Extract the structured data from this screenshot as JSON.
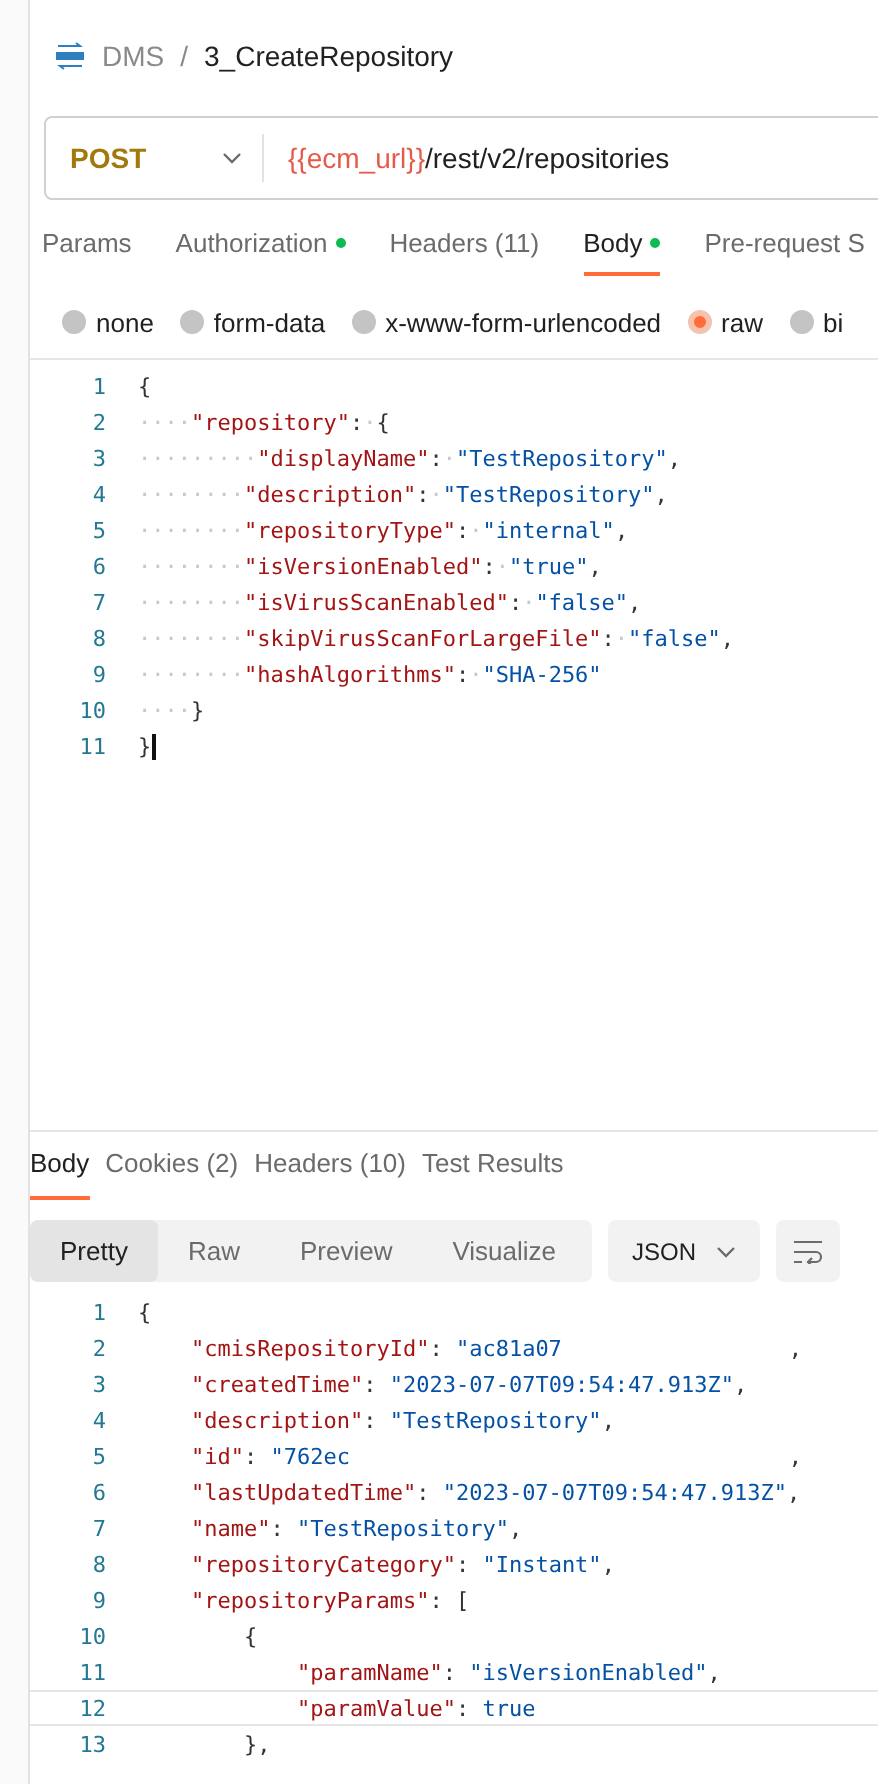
{
  "breadcrumb": {
    "collection": "DMS",
    "separator": "/",
    "request": "3_CreateRepository"
  },
  "request": {
    "method": "POST",
    "url_variable": "{{ecm_url}}",
    "url_path": "/rest/v2/repositories"
  },
  "request_tabs": [
    {
      "label": "Params",
      "selected": false,
      "dot": false
    },
    {
      "label": "Authorization",
      "selected": false,
      "dot": true
    },
    {
      "label": "Headers (11)",
      "selected": false,
      "dot": false
    },
    {
      "label": "Body",
      "selected": true,
      "dot": true
    },
    {
      "label": "Pre-request S",
      "selected": false,
      "dot": false
    }
  ],
  "body_types": [
    {
      "label": "none",
      "selected": false
    },
    {
      "label": "form-data",
      "selected": false
    },
    {
      "label": "x-www-form-urlencoded",
      "selected": false
    },
    {
      "label": "raw",
      "selected": true
    },
    {
      "label": "bi",
      "selected": false
    }
  ],
  "request_body": {
    "lines": [
      {
        "number": "1",
        "active": false,
        "tokens": [
          {
            "kind": "punct",
            "text": "{"
          }
        ]
      },
      {
        "number": "2",
        "active": false,
        "tokens": [
          {
            "kind": "ws",
            "text": "····"
          },
          {
            "kind": "key",
            "text": "\"repository\""
          },
          {
            "kind": "punct",
            "text": ":"
          },
          {
            "kind": "ws",
            "text": "·"
          },
          {
            "kind": "punct",
            "text": "{"
          }
        ]
      },
      {
        "number": "3",
        "active": false,
        "tokens": [
          {
            "kind": "ws",
            "text": "·········"
          },
          {
            "kind": "key",
            "text": "\"displayName\""
          },
          {
            "kind": "punct",
            "text": ":"
          },
          {
            "kind": "ws",
            "text": "·"
          },
          {
            "kind": "string",
            "text": "\"TestRepository\""
          },
          {
            "kind": "punct",
            "text": ","
          }
        ]
      },
      {
        "number": "4",
        "active": false,
        "tokens": [
          {
            "kind": "ws",
            "text": "········"
          },
          {
            "kind": "key",
            "text": "\"description\""
          },
          {
            "kind": "punct",
            "text": ":"
          },
          {
            "kind": "ws",
            "text": "·"
          },
          {
            "kind": "string",
            "text": "\"TestRepository\""
          },
          {
            "kind": "punct",
            "text": ","
          }
        ]
      },
      {
        "number": "5",
        "active": false,
        "tokens": [
          {
            "kind": "ws",
            "text": "········"
          },
          {
            "kind": "key",
            "text": "\"repositoryType\""
          },
          {
            "kind": "punct",
            "text": ":"
          },
          {
            "kind": "ws",
            "text": "·"
          },
          {
            "kind": "string",
            "text": "\"internal\""
          },
          {
            "kind": "punct",
            "text": ","
          }
        ]
      },
      {
        "number": "6",
        "active": false,
        "tokens": [
          {
            "kind": "ws",
            "text": "········"
          },
          {
            "kind": "key",
            "text": "\"isVersionEnabled\""
          },
          {
            "kind": "punct",
            "text": ":"
          },
          {
            "kind": "ws",
            "text": "·"
          },
          {
            "kind": "string",
            "text": "\"true\""
          },
          {
            "kind": "punct",
            "text": ","
          }
        ]
      },
      {
        "number": "7",
        "active": false,
        "tokens": [
          {
            "kind": "ws",
            "text": "········"
          },
          {
            "kind": "key",
            "text": "\"isVirusScanEnabled\""
          },
          {
            "kind": "punct",
            "text": ":"
          },
          {
            "kind": "ws",
            "text": "·"
          },
          {
            "kind": "string",
            "text": "\"false\""
          },
          {
            "kind": "punct",
            "text": ","
          }
        ]
      },
      {
        "number": "8",
        "active": false,
        "tokens": [
          {
            "kind": "ws",
            "text": "········"
          },
          {
            "kind": "key",
            "text": "\"skipVirusScanForLargeFile\""
          },
          {
            "kind": "punct",
            "text": ":"
          },
          {
            "kind": "ws",
            "text": "·"
          },
          {
            "kind": "string",
            "text": "\"false\""
          },
          {
            "kind": "punct",
            "text": ","
          }
        ]
      },
      {
        "number": "9",
        "active": false,
        "tokens": [
          {
            "kind": "ws",
            "text": "········"
          },
          {
            "kind": "key",
            "text": "\"hashAlgorithms\""
          },
          {
            "kind": "punct",
            "text": ":"
          },
          {
            "kind": "ws",
            "text": "·"
          },
          {
            "kind": "string",
            "text": "\"SHA-256\""
          }
        ]
      },
      {
        "number": "10",
        "active": false,
        "tokens": [
          {
            "kind": "ws",
            "text": "····"
          },
          {
            "kind": "punct",
            "text": "}"
          }
        ]
      },
      {
        "number": "11",
        "active": true,
        "tokens": [
          {
            "kind": "punct",
            "text": "}"
          }
        ]
      }
    ]
  },
  "response_tabs": [
    {
      "label": "Body",
      "selected": true
    },
    {
      "label": "Cookies (2)",
      "selected": false
    },
    {
      "label": "Headers (10)",
      "selected": false
    },
    {
      "label": "Test Results",
      "selected": false
    }
  ],
  "view_modes": [
    {
      "label": "Pretty",
      "selected": true
    },
    {
      "label": "Raw",
      "selected": false
    },
    {
      "label": "Preview",
      "selected": false
    },
    {
      "label": "Visualize",
      "selected": false
    }
  ],
  "format": "JSON",
  "response_body": {
    "lines": [
      {
        "number": "1",
        "active": false,
        "tokens": [
          {
            "kind": "punct",
            "text": "{"
          }
        ]
      },
      {
        "number": "2",
        "active": false,
        "tokens": [
          {
            "kind": "key",
            "text": "    \"cmisRepositoryId\""
          },
          {
            "kind": "punct",
            "text": ": "
          },
          {
            "kind": "string",
            "text": "\"ac81a07"
          },
          {
            "kind": "redacted"
          },
          {
            "kind": "punct",
            "text": ","
          }
        ]
      },
      {
        "number": "3",
        "active": false,
        "tokens": [
          {
            "kind": "key",
            "text": "    \"createdTime\""
          },
          {
            "kind": "punct",
            "text": ": "
          },
          {
            "kind": "string",
            "text": "\"2023-07-07T09:54:47.913Z\""
          },
          {
            "kind": "punct",
            "text": ","
          }
        ]
      },
      {
        "number": "4",
        "active": false,
        "tokens": [
          {
            "kind": "key",
            "text": "    \"description\""
          },
          {
            "kind": "punct",
            "text": ": "
          },
          {
            "kind": "string",
            "text": "\"TestRepository\""
          },
          {
            "kind": "punct",
            "text": ","
          }
        ]
      },
      {
        "number": "5",
        "active": false,
        "tokens": [
          {
            "kind": "key",
            "text": "    \"id\""
          },
          {
            "kind": "punct",
            "text": ": "
          },
          {
            "kind": "string",
            "text": "\"762ec"
          },
          {
            "kind": "redacted"
          },
          {
            "kind": "punct",
            "text": ","
          }
        ]
      },
      {
        "number": "6",
        "active": false,
        "tokens": [
          {
            "kind": "key",
            "text": "    \"lastUpdatedTime\""
          },
          {
            "kind": "punct",
            "text": ": "
          },
          {
            "kind": "string",
            "text": "\"2023-07-07T09:54:47.913Z\""
          },
          {
            "kind": "punct",
            "text": ","
          }
        ]
      },
      {
        "number": "7",
        "active": false,
        "tokens": [
          {
            "kind": "key",
            "text": "    \"name\""
          },
          {
            "kind": "punct",
            "text": ": "
          },
          {
            "kind": "string",
            "text": "\"TestRepository\""
          },
          {
            "kind": "punct",
            "text": ","
          }
        ]
      },
      {
        "number": "8",
        "active": false,
        "tokens": [
          {
            "kind": "key",
            "text": "    \"repositoryCategory\""
          },
          {
            "kind": "punct",
            "text": ": "
          },
          {
            "kind": "string",
            "text": "\"Instant\""
          },
          {
            "kind": "punct",
            "text": ","
          }
        ]
      },
      {
        "number": "9",
        "active": false,
        "tokens": [
          {
            "kind": "key",
            "text": "    \"repositoryParams\""
          },
          {
            "kind": "punct",
            "text": ": ["
          }
        ]
      },
      {
        "number": "10",
        "active": false,
        "tokens": [
          {
            "kind": "punct",
            "text": "        {"
          }
        ]
      },
      {
        "number": "11",
        "active": false,
        "tokens": [
          {
            "kind": "key",
            "text": "            \"paramName\""
          },
          {
            "kind": "punct",
            "text": ": "
          },
          {
            "kind": "string",
            "text": "\"isVersionEnabled\""
          },
          {
            "kind": "punct",
            "text": ","
          }
        ]
      },
      {
        "number": "12",
        "active": true,
        "tokens": [
          {
            "kind": "key",
            "text": "            \"paramValue\""
          },
          {
            "kind": "punct",
            "text": ": "
          },
          {
            "kind": "keyword",
            "text": "true"
          }
        ]
      },
      {
        "number": "13",
        "active": false,
        "tokens": [
          {
            "kind": "punct",
            "text": "        },"
          }
        ]
      }
    ]
  }
}
